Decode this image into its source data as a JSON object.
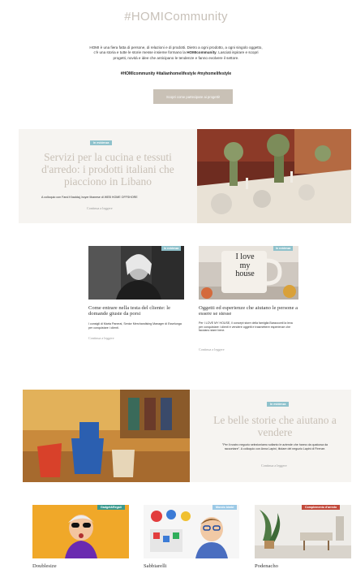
{
  "hero": {
    "title": "#HOMICommunity",
    "intro_line1_a": "HOMI è una fiera fatta di persone, di relazioni e di prodotti. Dietro a ogni prodotto, a ogni singolo oggetto,",
    "intro_line2_a": "c'è una storia e tutte le storie messe insieme formano la ",
    "intro_line2_b": "HOMIcommunity",
    "intro_line2_c": ". Lasciati ispirare e scopri",
    "intro_line3": "progetti, novità e idee che anticipano le tendenze e fanno evolvere il settore.",
    "hashtags": "#HOMIcommunity #italianhomelifestyle #myhomelifestyle",
    "cta_label": "Scopri come partecipare ai progetti!"
  },
  "feature1": {
    "tag": "In evidenza",
    "title": "Servizi per la cucina e tessuti d'arredo: i prodotti italiani che piacciono in Libano",
    "subtitle": "A colloquio con Fand Khaddaj, buyer libanese di WEB HOME OFFSHORE",
    "more": "Continua a leggere"
  },
  "article1": {
    "tag": "In evidenza",
    "title": "Come entrare nella testa del cliente: le domande giuste da porsi",
    "text": "I consigli di Marta Panerai, Senior Merchandising Manager di Esselunga per conquistare i clienti.",
    "more": "Continua a leggere"
  },
  "article2": {
    "tag": "In evidenza",
    "title": "Oggetti ed esperienze che aiutano le persone a essere se stesse",
    "text": "Per I LOVE MY HOUSE, il concept store della famiglia Baracconti la leva per conquistare i clienti è vendere oggetti e trasmettere esperienze che facciano stare bene.",
    "more": "Continua a leggere",
    "mug_line1": "I love",
    "mug_line2": "my",
    "mug_line3": "house"
  },
  "feature2": {
    "tag": "In evidenza",
    "title": "Le belle storie che aiutano a vendere",
    "text": "\"Per il nostro negozio selezioniamo soltanto le aziende che hanno da qualcosa da raccontare\". A colloquio con Anna Lapini, titolare del negozio Lapini di Firenze.",
    "more": "Continua a leggere"
  },
  "bottom": {
    "items": [
      {
        "tag": "Gadget&Regali",
        "tag_color": "#3b9a8e",
        "label": "Doublesize"
      },
      {
        "tag": "Mondo bimbi",
        "tag_color": "#9bc9e6",
        "label": "Sabbiarelli"
      },
      {
        "tag": "Complemento d'arredo",
        "tag_color": "#c24a3c",
        "label": "Podenacho"
      }
    ]
  }
}
